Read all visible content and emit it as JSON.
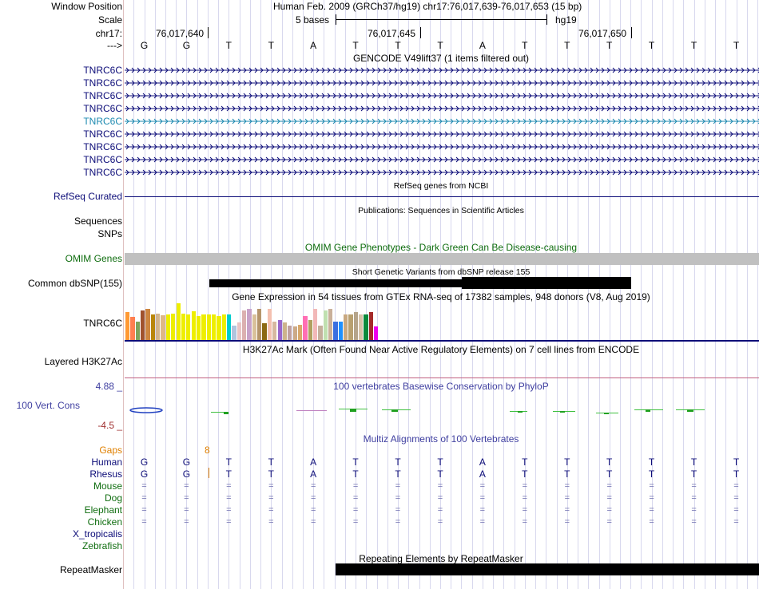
{
  "header": {
    "window_position_label": "Window Position",
    "window_position_value": "Human Feb. 2009 (GRCh37/hg19)   chr17:76,017,639-76,017,653 (15 bp)",
    "scale_label": "Scale",
    "scale_value": "5 bases",
    "scale_db": "hg19",
    "chrom_label": "chr17:",
    "strand_label": "--->",
    "positions": [
      "76,017,640",
      "76,017,645",
      "76,017,650"
    ],
    "bases": [
      "G",
      "G",
      "T",
      "T",
      "A",
      "T",
      "T",
      "T",
      "A",
      "T",
      "T",
      "T",
      "T",
      "T",
      "T"
    ]
  },
  "tracks": {
    "gencode": {
      "title": "GENCODE V49lift37 (1 items filtered out)",
      "genes": [
        "TNRC6C",
        "TNRC6C",
        "TNRC6C",
        "TNRC6C",
        "TNRC6C",
        "TNRC6C",
        "TNRC6C",
        "TNRC6C",
        "TNRC6C"
      ],
      "highlight_color": "#1d8ab0",
      "color": "#0c0c78"
    },
    "refseq": {
      "label": "RefSeq Curated",
      "title": "RefSeq genes from NCBI"
    },
    "publications": {
      "title": "Publications: Sequences in Scientific Articles",
      "label1": "Sequences",
      "label2": "SNPs"
    },
    "omim": {
      "title": "OMIM Gene Phenotypes - Dark Green Can Be Disease-causing",
      "label": "OMIM Genes",
      "color": "#0f6d0f"
    },
    "dbsnp": {
      "title": "Short Genetic Variants from dbSNP release 155",
      "label": "Common dbSNP(155)"
    },
    "gtex": {
      "title": "Gene Expression in 54 tissues from GTEx RNA-seq of 17382 samples, 948 donors (V8, Aug 2019)",
      "label": "TNRC6C",
      "bars": [
        {
          "h": 0.75,
          "c": "#ff9933"
        },
        {
          "h": 0.62,
          "c": "#ff7f50"
        },
        {
          "h": 0.5,
          "c": "#7fa35c"
        },
        {
          "h": 0.8,
          "c": "#a0522d"
        },
        {
          "h": 0.85,
          "c": "#cd853f"
        },
        {
          "h": 0.7,
          "c": "#b8860b"
        },
        {
          "h": 0.72,
          "c": "#d2b48c"
        },
        {
          "h": 0.68,
          "c": "#deb887"
        },
        {
          "h": 0.7,
          "c": "#eeee00"
        },
        {
          "h": 0.72,
          "c": "#eeee00"
        },
        {
          "h": 1.0,
          "c": "#eeee00"
        },
        {
          "h": 0.72,
          "c": "#eeee00"
        },
        {
          "h": 0.7,
          "c": "#eeee00"
        },
        {
          "h": 0.78,
          "c": "#eeee00"
        },
        {
          "h": 0.66,
          "c": "#eeee00"
        },
        {
          "h": 0.7,
          "c": "#eeee00"
        },
        {
          "h": 0.7,
          "c": "#eeee00"
        },
        {
          "h": 0.7,
          "c": "#eeee00"
        },
        {
          "h": 0.66,
          "c": "#eeee00"
        },
        {
          "h": 0.7,
          "c": "#eeee00"
        },
        {
          "h": 0.7,
          "c": "#00cdcd"
        },
        {
          "h": 0.4,
          "c": "#b0c4de"
        },
        {
          "h": 0.48,
          "c": "#e8c4c4"
        },
        {
          "h": 0.8,
          "c": "#dbb0b0"
        },
        {
          "h": 0.85,
          "c": "#c8a2c8"
        },
        {
          "h": 0.7,
          "c": "#d9c19a"
        },
        {
          "h": 0.85,
          "c": "#b5956b"
        },
        {
          "h": 0.45,
          "c": "#8b6914"
        },
        {
          "h": 0.85,
          "c": "#f4c0b0"
        },
        {
          "h": 0.5,
          "c": "#d7b8a0"
        },
        {
          "h": 0.55,
          "c": "#9966cc"
        },
        {
          "h": 0.48,
          "c": "#cdb38b"
        },
        {
          "h": 0.4,
          "c": "#bfa0a0"
        },
        {
          "h": 0.38,
          "c": "#ccaa88"
        },
        {
          "h": 0.42,
          "c": "#d8a86c"
        },
        {
          "h": 0.65,
          "c": "#ff6eb4"
        },
        {
          "h": 0.55,
          "c": "#b0a060"
        },
        {
          "h": 0.85,
          "c": "#f2b8b8"
        },
        {
          "h": 0.4,
          "c": "#c4b09c"
        },
        {
          "h": 0.8,
          "c": "#c0e0b0"
        },
        {
          "h": 0.85,
          "c": "#c9b09a"
        },
        {
          "h": 0.5,
          "c": "#3a6fe0"
        },
        {
          "h": 0.5,
          "c": "#1e90ff"
        },
        {
          "h": 0.7,
          "c": "#c8a880"
        },
        {
          "h": 0.7,
          "c": "#b8a070"
        },
        {
          "h": 0.75,
          "c": "#b5a48a"
        },
        {
          "h": 0.7,
          "c": "#d6c2a8"
        },
        {
          "h": 0.7,
          "c": "#0b8a3b"
        },
        {
          "h": 0.76,
          "c": "#a52a2a"
        },
        {
          "h": 0.36,
          "c": "#ee00ee"
        }
      ]
    },
    "h3k27ac": {
      "title": "H3K27Ac Mark (Often Found Near Active Regulatory Elements) on 7 cell lines from ENCODE",
      "label": "Layered H3K27Ac"
    },
    "phylop": {
      "title": "100 vertebrates Basewise Conservation by PhyloP",
      "label": "100 Vert. Cons",
      "max": "4.88 _",
      "min": "-4.5 _",
      "title_color": "#3f3fa0"
    },
    "multiz": {
      "title": "Multiz Alignments of 100 Vertebrates",
      "gaps_label": "Gaps",
      "gaps_value": "8",
      "species": [
        {
          "name": "Human",
          "color": "#0c0c78",
          "seq": [
            "G",
            "G",
            "T",
            "T",
            "A",
            "T",
            "T",
            "T",
            "A",
            "T",
            "T",
            "T",
            "T",
            "T",
            "T"
          ]
        },
        {
          "name": "Rhesus",
          "color": "#0c0c78",
          "seq": [
            "G",
            "G",
            "T",
            "T",
            "A",
            "T",
            "T",
            "T",
            "A",
            "T",
            "T",
            "T",
            "T",
            "T",
            "T"
          ]
        },
        {
          "name": "Mouse",
          "color": "#0f6d0f",
          "seq": [
            "=",
            "=",
            "=",
            "=",
            "=",
            "=",
            "=",
            "=",
            "=",
            "=",
            "=",
            "=",
            "=",
            "=",
            "="
          ]
        },
        {
          "name": "Dog",
          "color": "#0f6d0f",
          "seq": [
            "=",
            "=",
            "=",
            "=",
            "=",
            "=",
            "=",
            "=",
            "=",
            "=",
            "=",
            "=",
            "=",
            "=",
            "="
          ]
        },
        {
          "name": "Elephant",
          "color": "#0f6d0f",
          "seq": [
            "=",
            "=",
            "=",
            "=",
            "=",
            "=",
            "=",
            "=",
            "=",
            "=",
            "=",
            "=",
            "=",
            "=",
            "="
          ]
        },
        {
          "name": "Chicken",
          "color": "#0f6d0f",
          "seq": [
            "=",
            "=",
            "=",
            "=",
            "=",
            "=",
            "=",
            "=",
            "=",
            "=",
            "=",
            "=",
            "=",
            "=",
            "="
          ]
        },
        {
          "name": "X_tropicalis",
          "color": "#0c0c78",
          "seq": []
        },
        {
          "name": "Zebrafish",
          "color": "#0f6d0f",
          "seq": []
        }
      ]
    },
    "repeatmasker": {
      "title": "Repeating Elements by RepeatMasker",
      "label": "RepeatMasker"
    }
  }
}
